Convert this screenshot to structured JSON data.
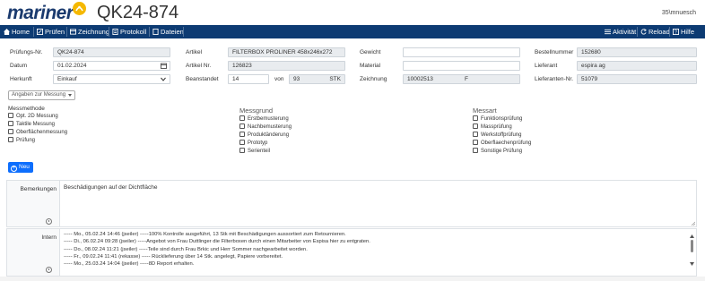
{
  "header": {
    "logo_text": "mariner",
    "doc_title": "QK24-874",
    "user": "35\\mnuesch"
  },
  "nav": {
    "left": [
      {
        "label": "Home",
        "icon": "home-icon"
      },
      {
        "label": "Prüfen",
        "icon": "edit-icon"
      },
      {
        "label": "Zeichnung",
        "icon": "drawing-icon"
      },
      {
        "label": "Protokoll",
        "icon": "document-icon"
      },
      {
        "label": "Dateien",
        "icon": "folder-icon"
      }
    ],
    "right": [
      {
        "label": "Aktivität",
        "icon": "menu-icon"
      },
      {
        "label": "Reload",
        "icon": "reload-icon"
      },
      {
        "label": "Hilfe",
        "icon": "help-icon"
      }
    ]
  },
  "form": {
    "pruefungs_nr": {
      "label": "Prüfungs-Nr.",
      "value": "QK24-874"
    },
    "datum": {
      "label": "Datum",
      "value": "01.02.2024"
    },
    "herkunft": {
      "label": "Herkunft",
      "value": "Einkauf"
    },
    "artikel": {
      "label": "Artikel",
      "value": "FILTERBOX PROLINER 458x246x272"
    },
    "artikel_nr": {
      "label": "Artikel Nr.",
      "value": "126823"
    },
    "beanstandet": {
      "label": "Beanstandet",
      "value": "14",
      "von_label": "von",
      "von_value": "93",
      "unit": "STK"
    },
    "gewicht": {
      "label": "Gewicht",
      "value": ""
    },
    "material": {
      "label": "Material",
      "value": ""
    },
    "zeichnung": {
      "label": "Zeichnung",
      "value": "10002513",
      "suffix": "F"
    },
    "bestellnummer": {
      "label": "Bestellnummer",
      "value": "152680"
    },
    "lieferant": {
      "label": "Lieferant",
      "value": "espira ag"
    },
    "lieferanten_nr": {
      "label": "Lieferanten-Nr.",
      "value": "51079"
    }
  },
  "dropdown_label": "Angaben zur Messung",
  "messmethode": {
    "title": "Messmethode",
    "items": [
      "Opt. 2D Messung",
      "Taktile Messung",
      "Oberflächenmessung",
      "Prüfung"
    ]
  },
  "messgrund": {
    "title": "Messgrund",
    "items": [
      "Erstbemusterung",
      "Nachbemusterung",
      "Produktänderung",
      "Prototyp",
      "Serienteil"
    ]
  },
  "messart": {
    "title": "Messart",
    "items": [
      "Funktionsprüfung",
      "Massprüfung",
      "Werkstoffprüfung",
      "Oberflaechenprüfung",
      "Sonstige Prüfung"
    ]
  },
  "new_button": "Neu",
  "bemerkungen": {
    "label": "Bemerkungen",
    "text": "Beschädigungen auf der Dichtfläche"
  },
  "intern": {
    "label": "Intern",
    "lines": [
      "----- Mo., 05.02.24 14:46 (jseiler) -----100% Kontrolle ausgeführt, 13 Stk mit Beschädigungen aussortiert zum Retournieren.",
      "----- Di., 06.02.24 09:28 (jseiler) -----Angebot von Frau Duttlinger die Filterboxen durch einen Mitarbeiter von Espisa hier zu entgraten.",
      "----- Do., 08.02.24 11:21 (jseiler) -----Teile sind durch Frau Brkic und Herr Sommer nachgearbeitet worden.",
      "----- Fr., 09.02.24 11:41 (rekasse) ----- Rücklieferung über 14 Stk. angelegt, Papiere vorbereitet.",
      "----- Mo., 25.03.24 14:04 (jseiler) -----8D Report erhalten."
    ]
  }
}
